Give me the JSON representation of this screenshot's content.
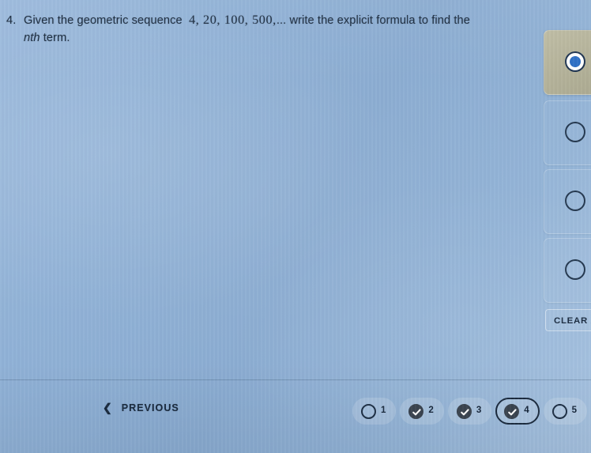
{
  "colors": {
    "screen_bg": "#8fb1d6",
    "text_dark": "#17283c",
    "selected_option_bg": "#b3b198",
    "radio_fill": "#2e6fc4",
    "nav_done": "#3a4450"
  },
  "question": {
    "number": "4.",
    "line1_a": "Given the geometric sequence",
    "sequence": "4, 20, 100, 500,",
    "line1_b": "... write the explicit formula to find the",
    "line2_italic": "nth",
    "line2_rest": "term."
  },
  "options": [
    {
      "id": "option-a",
      "selected": true,
      "radio_icon": "radio-selected-icon"
    },
    {
      "id": "option-b",
      "selected": false,
      "radio_icon": "radio-unselected-icon"
    },
    {
      "id": "option-c",
      "selected": false,
      "radio_icon": "radio-unselected-icon"
    },
    {
      "id": "option-d",
      "selected": false,
      "radio_icon": "radio-unselected-icon"
    }
  ],
  "clear_all": {
    "label": "CLEAR ALL"
  },
  "bottom_bar": {
    "previous_label": "PREVIOUS",
    "previous_icon": "chevron-left-icon"
  },
  "question_nav": [
    {
      "label": "1",
      "state": "unanswered",
      "current": false,
      "icon": "circle-empty-icon"
    },
    {
      "label": "2",
      "state": "answered",
      "current": false,
      "icon": "check-circle-icon"
    },
    {
      "label": "3",
      "state": "answered",
      "current": false,
      "icon": "check-circle-icon"
    },
    {
      "label": "4",
      "state": "answered",
      "current": true,
      "icon": "check-circle-icon"
    },
    {
      "label": "5",
      "state": "unanswered",
      "current": false,
      "icon": "circle-empty-icon"
    }
  ]
}
